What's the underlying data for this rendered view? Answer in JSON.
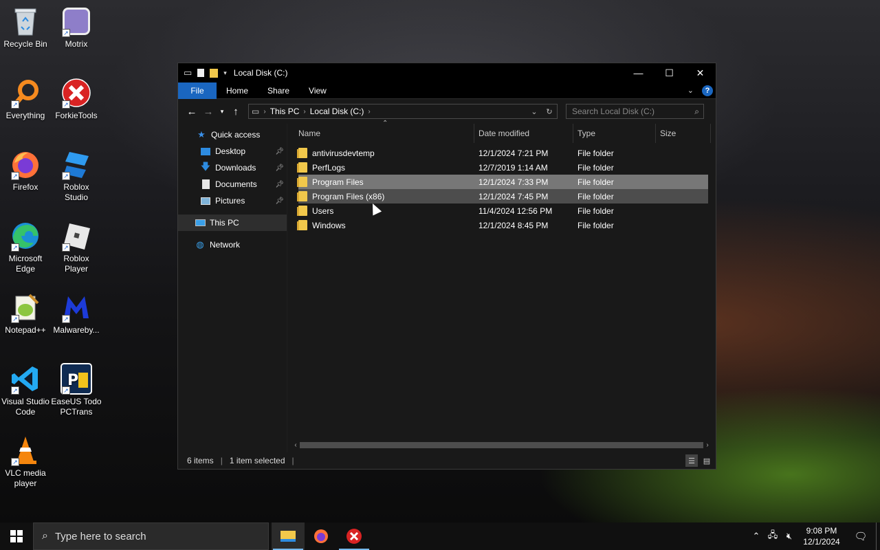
{
  "desktop": {
    "icons": [
      {
        "label": "Recycle Bin",
        "icon": "recycle-bin-icon"
      },
      {
        "label": "Motrix",
        "icon": "motrix-icon"
      },
      {
        "label": "Everything",
        "icon": "everything-search-icon"
      },
      {
        "label": "ForkieTools",
        "icon": "red-x-icon"
      },
      {
        "label": "Firefox",
        "icon": "firefox-icon"
      },
      {
        "label": "Roblox Studio",
        "icon": "roblox-studio-icon"
      },
      {
        "label": "Microsoft Edge",
        "icon": "edge-icon"
      },
      {
        "label": "Roblox Player",
        "icon": "roblox-player-icon"
      },
      {
        "label": "Notepad++",
        "icon": "notepadpp-icon"
      },
      {
        "label": "Malwareby...",
        "icon": "malwarebytes-icon"
      },
      {
        "label": "Visual Studio Code",
        "icon": "vscode-icon"
      },
      {
        "label": "EaseUS Todo PCTrans",
        "icon": "easeus-icon"
      },
      {
        "label": "VLC media player",
        "icon": "vlc-icon"
      }
    ]
  },
  "explorer": {
    "title": "Local Disk (C:)",
    "ribbon_tabs": [
      "File",
      "Home",
      "Share",
      "View"
    ],
    "breadcrumb": [
      "This PC",
      "Local Disk (C:)"
    ],
    "search_placeholder": "Search Local Disk (C:)",
    "nav": {
      "quick_access": "Quick access",
      "pinned": [
        "Desktop",
        "Downloads",
        "Documents",
        "Pictures"
      ],
      "this_pc": "This PC",
      "network": "Network"
    },
    "columns": [
      "Name",
      "Date modified",
      "Type",
      "Size"
    ],
    "files": [
      {
        "name": "antivirusdevtemp",
        "date": "12/1/2024 7:21 PM",
        "type": "File folder"
      },
      {
        "name": "PerfLogs",
        "date": "12/7/2019 1:14 AM",
        "type": "File folder"
      },
      {
        "name": "Program Files",
        "date": "12/1/2024 7:33 PM",
        "type": "File folder"
      },
      {
        "name": "Program Files (x86)",
        "date": "12/1/2024 7:45 PM",
        "type": "File folder"
      },
      {
        "name": "Users",
        "date": "11/4/2024 12:56 PM",
        "type": "File folder"
      },
      {
        "name": "Windows",
        "date": "12/1/2024 8:45 PM",
        "type": "File folder"
      }
    ],
    "status": {
      "items": "6 items",
      "selected": "1 item selected"
    }
  },
  "taskbar": {
    "search_placeholder": "Type here to search",
    "time": "9:08 PM",
    "date": "12/1/2024"
  },
  "colors": {
    "accent": "#1a66c0",
    "folder": "#f1c84b",
    "selection": "#777777"
  }
}
